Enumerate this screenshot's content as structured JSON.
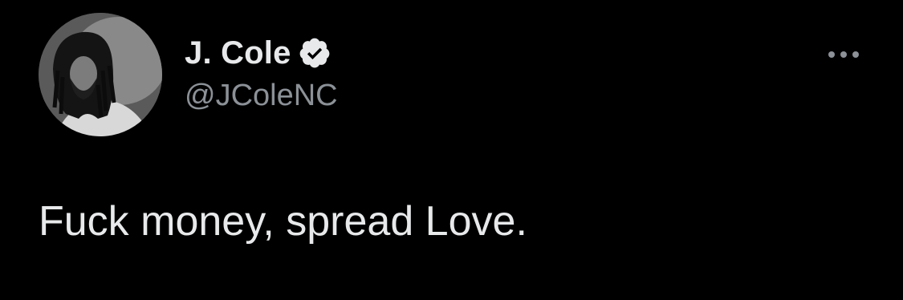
{
  "tweet": {
    "author": {
      "display_name": "J. Cole",
      "handle": "@JColeNC",
      "verified": true,
      "avatar_icon": "profile-photo"
    },
    "text": "Fuck money, spread Love.",
    "menu_icon": "more-horizontal-icon"
  },
  "colors": {
    "background": "#000000",
    "primary_text": "#e7e9ea",
    "secondary_text": "#8b9197",
    "verified_badge": "#e7e9ea"
  }
}
